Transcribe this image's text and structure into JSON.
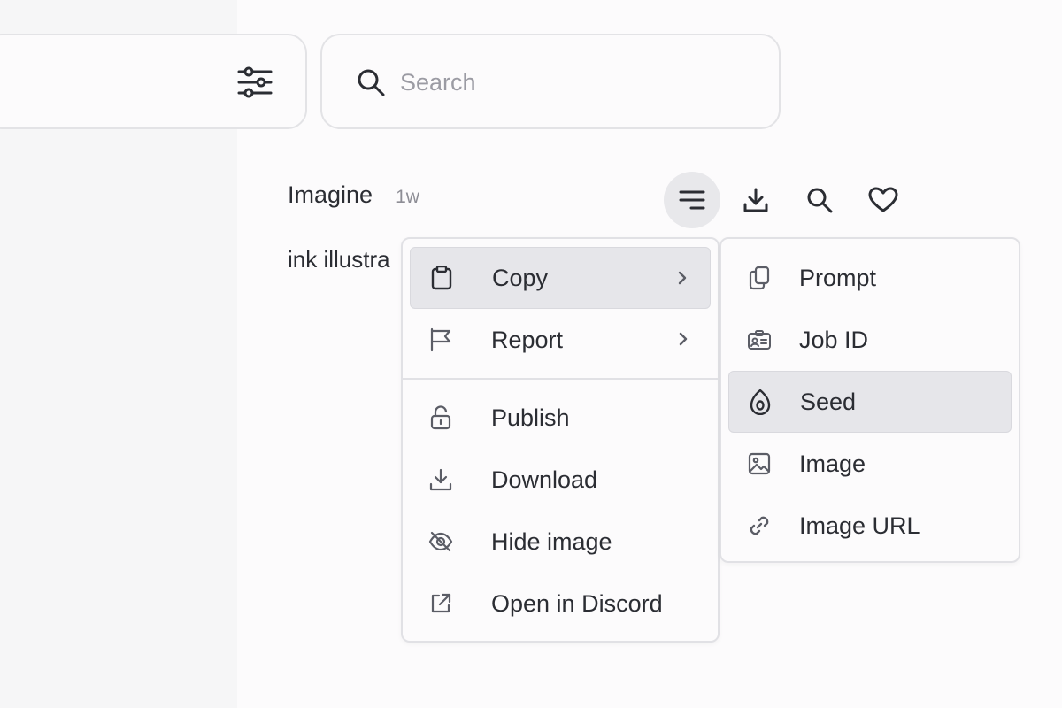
{
  "search": {
    "placeholder": "Search",
    "value": ""
  },
  "job": {
    "title": "Imagine",
    "time": "1w",
    "prompt_snippet": "ink illustra"
  },
  "actions": [
    {
      "name": "menu",
      "icon": "menu-lines-icon",
      "active": true
    },
    {
      "name": "download",
      "icon": "download-icon"
    },
    {
      "name": "search",
      "icon": "search-icon"
    },
    {
      "name": "favorite",
      "icon": "heart-icon"
    }
  ],
  "context_menu": {
    "items": [
      {
        "label": "Copy",
        "icon": "clipboard-icon",
        "submenu": true,
        "highlighted": true
      },
      {
        "label": "Report",
        "icon": "flag-icon",
        "submenu": true
      },
      {
        "label": "Publish",
        "icon": "unlock-icon"
      },
      {
        "label": "Download",
        "icon": "download-icon"
      },
      {
        "label": "Hide image",
        "icon": "eye-off-icon"
      },
      {
        "label": "Open in Discord",
        "icon": "external-link-icon"
      }
    ]
  },
  "copy_submenu": {
    "items": [
      {
        "label": "Prompt",
        "icon": "copy-icon"
      },
      {
        "label": "Job ID",
        "icon": "id-card-icon"
      },
      {
        "label": "Seed",
        "icon": "seed-icon",
        "highlighted": true
      },
      {
        "label": "Image",
        "icon": "image-icon"
      },
      {
        "label": "Image URL",
        "icon": "link-icon"
      }
    ]
  },
  "colors": {
    "accent_bg": "#e6e6ea",
    "border": "#e1e1e5",
    "text": "#2b2d33",
    "muted": "#9b9ba3"
  }
}
